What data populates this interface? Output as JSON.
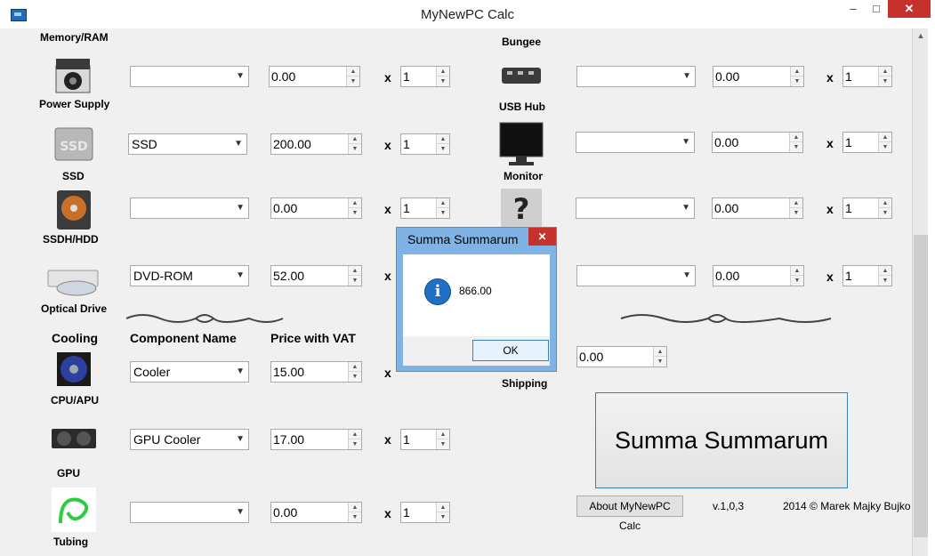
{
  "window": {
    "title": "MyNewPC Calc",
    "min": "–",
    "max": "□",
    "close": "✕"
  },
  "left": {
    "top_label": "Memory/RAM",
    "rows": [
      {
        "label": "Power Supply",
        "combo": "",
        "price": "0.00",
        "qty": "1",
        "icon": "power-supply-icon"
      },
      {
        "label": "SSD",
        "combo": "SSD",
        "price": "200.00",
        "qty": "1",
        "icon": "ssd-icon"
      },
      {
        "label": "SSDH/HDD",
        "combo": "",
        "price": "0.00",
        "qty": "1",
        "icon": "hdd-icon"
      },
      {
        "label": "Optical Drive",
        "combo": "DVD-ROM",
        "price": "52.00",
        "qty": "",
        "icon": "optical-drive-icon"
      }
    ],
    "section_title": "Cooling",
    "header_component": "Component Name",
    "header_price": "Price with VAT",
    "cooling_rows": [
      {
        "label": "CPU/APU",
        "combo": "Cooler",
        "price": "15.00",
        "qty": "",
        "icon": "cpu-cooler-icon"
      },
      {
        "label": "GPU",
        "combo": "GPU Cooler",
        "price": "17.00",
        "qty": "1",
        "icon": "gpu-icon"
      },
      {
        "label": "Tubing",
        "combo": "",
        "price": "0.00",
        "qty": "1",
        "icon": "tubing-icon"
      }
    ]
  },
  "right": {
    "top_label": "Bungee",
    "rows": [
      {
        "label": "USB Hub",
        "combo": "",
        "price": "0.00",
        "qty": "1",
        "icon": "usb-hub-icon"
      },
      {
        "label": "Monitor",
        "combo": "",
        "price": "0.00",
        "qty": "1",
        "icon": "monitor-icon"
      },
      {
        "label": "",
        "combo": "",
        "price": "0.00",
        "qty": "1",
        "icon": "question-icon"
      },
      {
        "label": "",
        "combo": "",
        "price": "0.00",
        "qty": "1",
        "icon": ""
      }
    ],
    "shipping_label": "Shipping",
    "shipping_price": "0.00"
  },
  "x_symbol": "x",
  "summa_button": "Summa Summarum",
  "about_button": "About MyNewPC Calc",
  "version": "v.1,0,3",
  "copyright": "2014 © Marek Majky Bujko",
  "dialog": {
    "title": "Summa Summarum",
    "message": "866.00",
    "ok": "OK",
    "close": "✕",
    "info_glyph": "i"
  },
  "colors": {
    "accent": "#3c7fb1",
    "close_red": "#c7312b",
    "dialog_frame": "#7fb2e5"
  }
}
